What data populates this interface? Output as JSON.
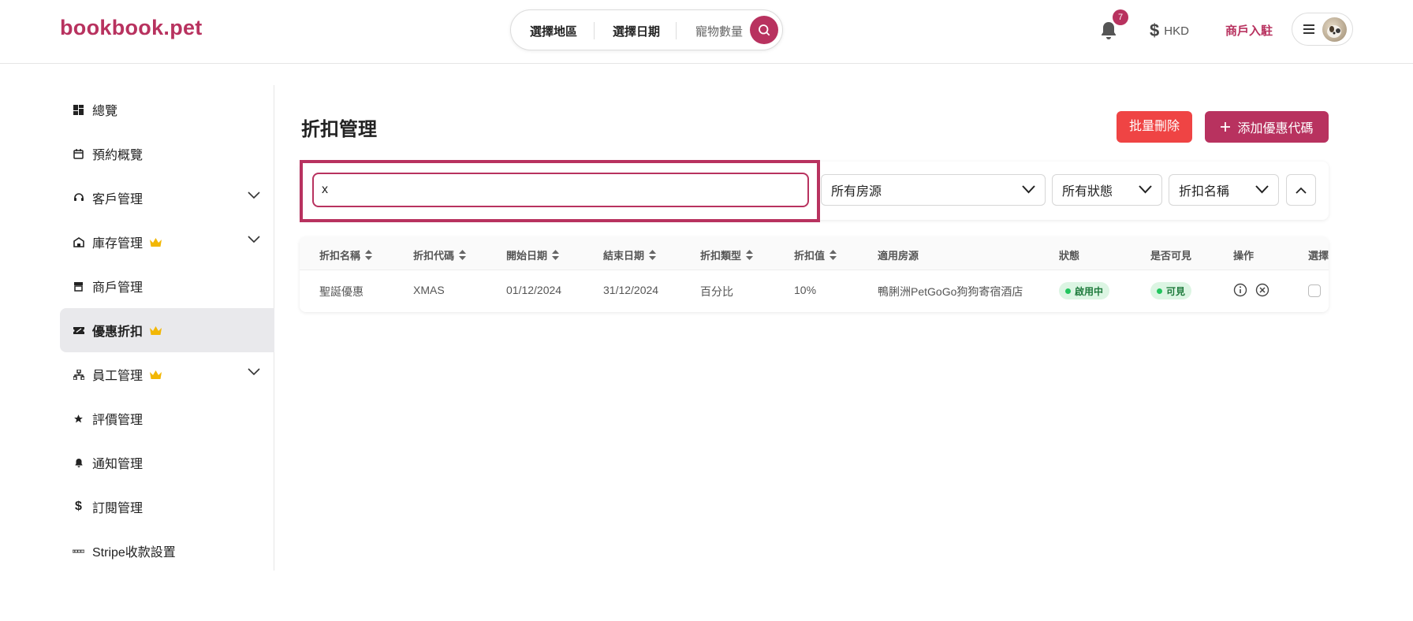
{
  "header": {
    "logo": "bookbook.pet",
    "search": {
      "region": "選擇地區",
      "date": "選擇日期",
      "pets": "寵物數量"
    },
    "notifications_count": "7",
    "currency": "HKD",
    "merchant_link": "商戶入駐"
  },
  "sidebar": {
    "items": [
      {
        "label": "總覽",
        "icon": "dashboard-icon"
      },
      {
        "label": "預約概覽",
        "icon": "calendar-icon"
      },
      {
        "label": "客戶管理",
        "icon": "headset-icon",
        "expandable": true
      },
      {
        "label": "庫存管理",
        "icon": "store-icon",
        "premium": true,
        "expandable": true
      },
      {
        "label": "商戶管理",
        "icon": "shop-icon"
      },
      {
        "label": "優惠折扣",
        "icon": "ticket-icon",
        "premium": true,
        "active": true
      },
      {
        "label": "員工管理",
        "icon": "org-chart-icon",
        "premium": true,
        "expandable": true
      },
      {
        "label": "評價管理",
        "icon": "star-icon"
      },
      {
        "label": "通知管理",
        "icon": "bell-icon"
      },
      {
        "label": "訂閱管理",
        "icon": "dollar-icon"
      },
      {
        "label": "Stripe收款設置",
        "icon": "stripe-icon"
      }
    ]
  },
  "main": {
    "title": "折扣管理",
    "bulk_delete": "批量刪除",
    "add_code": "添加優惠代碼",
    "search_value": "x",
    "filters": {
      "property": "所有房源",
      "status": "所有狀態",
      "sort": "折扣名稱"
    },
    "table": {
      "headers": [
        "折扣名稱",
        "折扣代碼",
        "開始日期",
        "結束日期",
        "折扣類型",
        "折扣值",
        "適用房源",
        "狀態",
        "是否可見",
        "操作",
        "選擇"
      ],
      "rows": [
        {
          "name": "聖誕優惠",
          "code": "XMAS",
          "start": "01/12/2024",
          "end": "31/12/2024",
          "type": "百分比",
          "value": "10%",
          "property": "鴨脷洲PetGoGo狗狗寄宿酒店",
          "status": "啟用中",
          "visible": "可見"
        }
      ]
    }
  },
  "colors": {
    "brand": "#b8325f",
    "danger": "#ef4444",
    "success": "#22c55e"
  }
}
